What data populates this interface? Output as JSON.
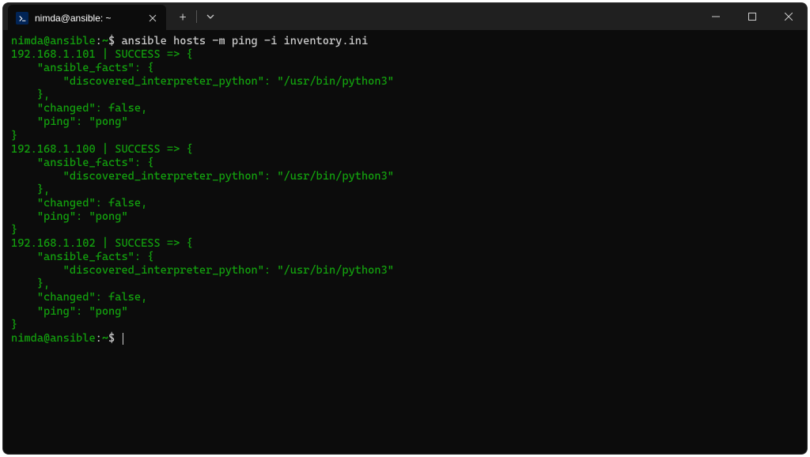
{
  "window": {
    "tab_title": "nimda@ansible: ~",
    "tab_icon_glyph": ">_"
  },
  "prompt": {
    "user_host": "nimda@ansible",
    "cwd": "~",
    "symbol": "$"
  },
  "command": "ansible hosts -m ping -i inventory.ini",
  "results": [
    {
      "host": "192.168.1.101",
      "status": "SUCCESS",
      "ansible_facts": {
        "discovered_interpreter_python": "/usr/bin/python3"
      },
      "changed": false,
      "ping": "pong"
    },
    {
      "host": "192.168.1.100",
      "status": "SUCCESS",
      "ansible_facts": {
        "discovered_interpreter_python": "/usr/bin/python3"
      },
      "changed": false,
      "ping": "pong"
    },
    {
      "host": "192.168.1.102",
      "status": "SUCCESS",
      "ansible_facts": {
        "discovered_interpreter_python": "/usr/bin/python3"
      },
      "changed": false,
      "ping": "pong"
    }
  ]
}
